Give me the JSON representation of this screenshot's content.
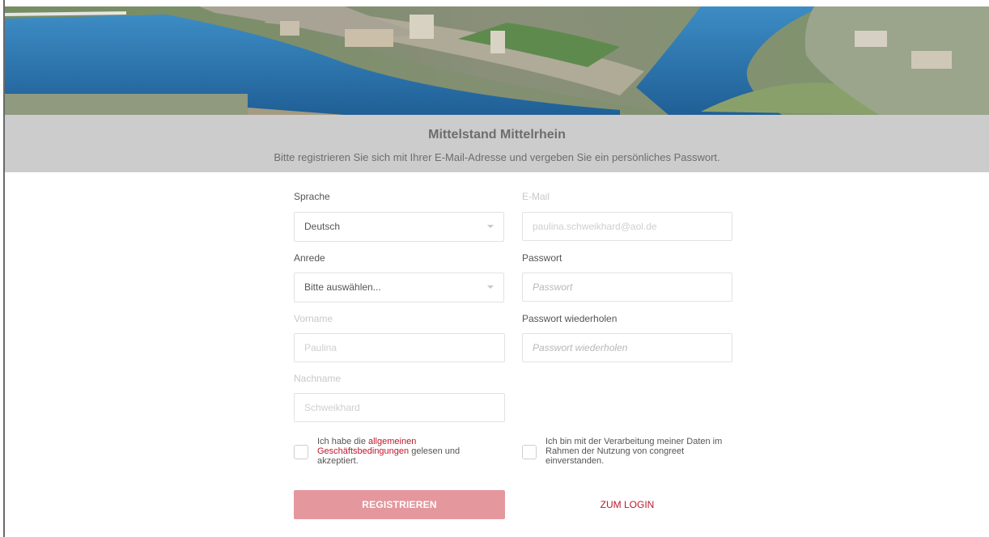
{
  "banner": {
    "title": "Mittelstand Mittelrhein",
    "subtitle": "Bitte registrieren Sie sich mit Ihrer E-Mail-Adresse und vergeben Sie ein persönliches Passwort."
  },
  "form": {
    "language": {
      "label": "Sprache",
      "value": "Deutsch"
    },
    "salutation": {
      "label": "Anrede",
      "value": "Bitte auswählen..."
    },
    "first_name": {
      "label": "Vorname",
      "value": "Paulina"
    },
    "last_name": {
      "label": "Nachname",
      "value": "Schweikhard"
    },
    "email": {
      "label": "E-Mail",
      "value": "paulina.schweikhard@aol.de"
    },
    "password": {
      "label": "Passwort",
      "placeholder": "Passwort"
    },
    "password_repeat": {
      "label": "Passwort wiederholen",
      "placeholder": "Passwort wiederholen"
    },
    "terms": {
      "prefix": "Ich habe die ",
      "link": "allgemeinen Geschäftsbedingungen",
      "suffix": " gelesen und akzeptiert."
    },
    "privacy": {
      "text": "Ich bin mit der Verarbeitung meiner Daten im Rahmen der Nutzung von congreet einverstanden."
    },
    "register_label": "REGISTRIEREN",
    "login_label": "ZUM LOGIN"
  },
  "colors": {
    "accent": "#c0172c",
    "button": "#e4979d",
    "banner_bg": "#cccccc",
    "water": "#2f7fb8"
  },
  "icons": {
    "select_caret": "chevron-down-icon"
  }
}
